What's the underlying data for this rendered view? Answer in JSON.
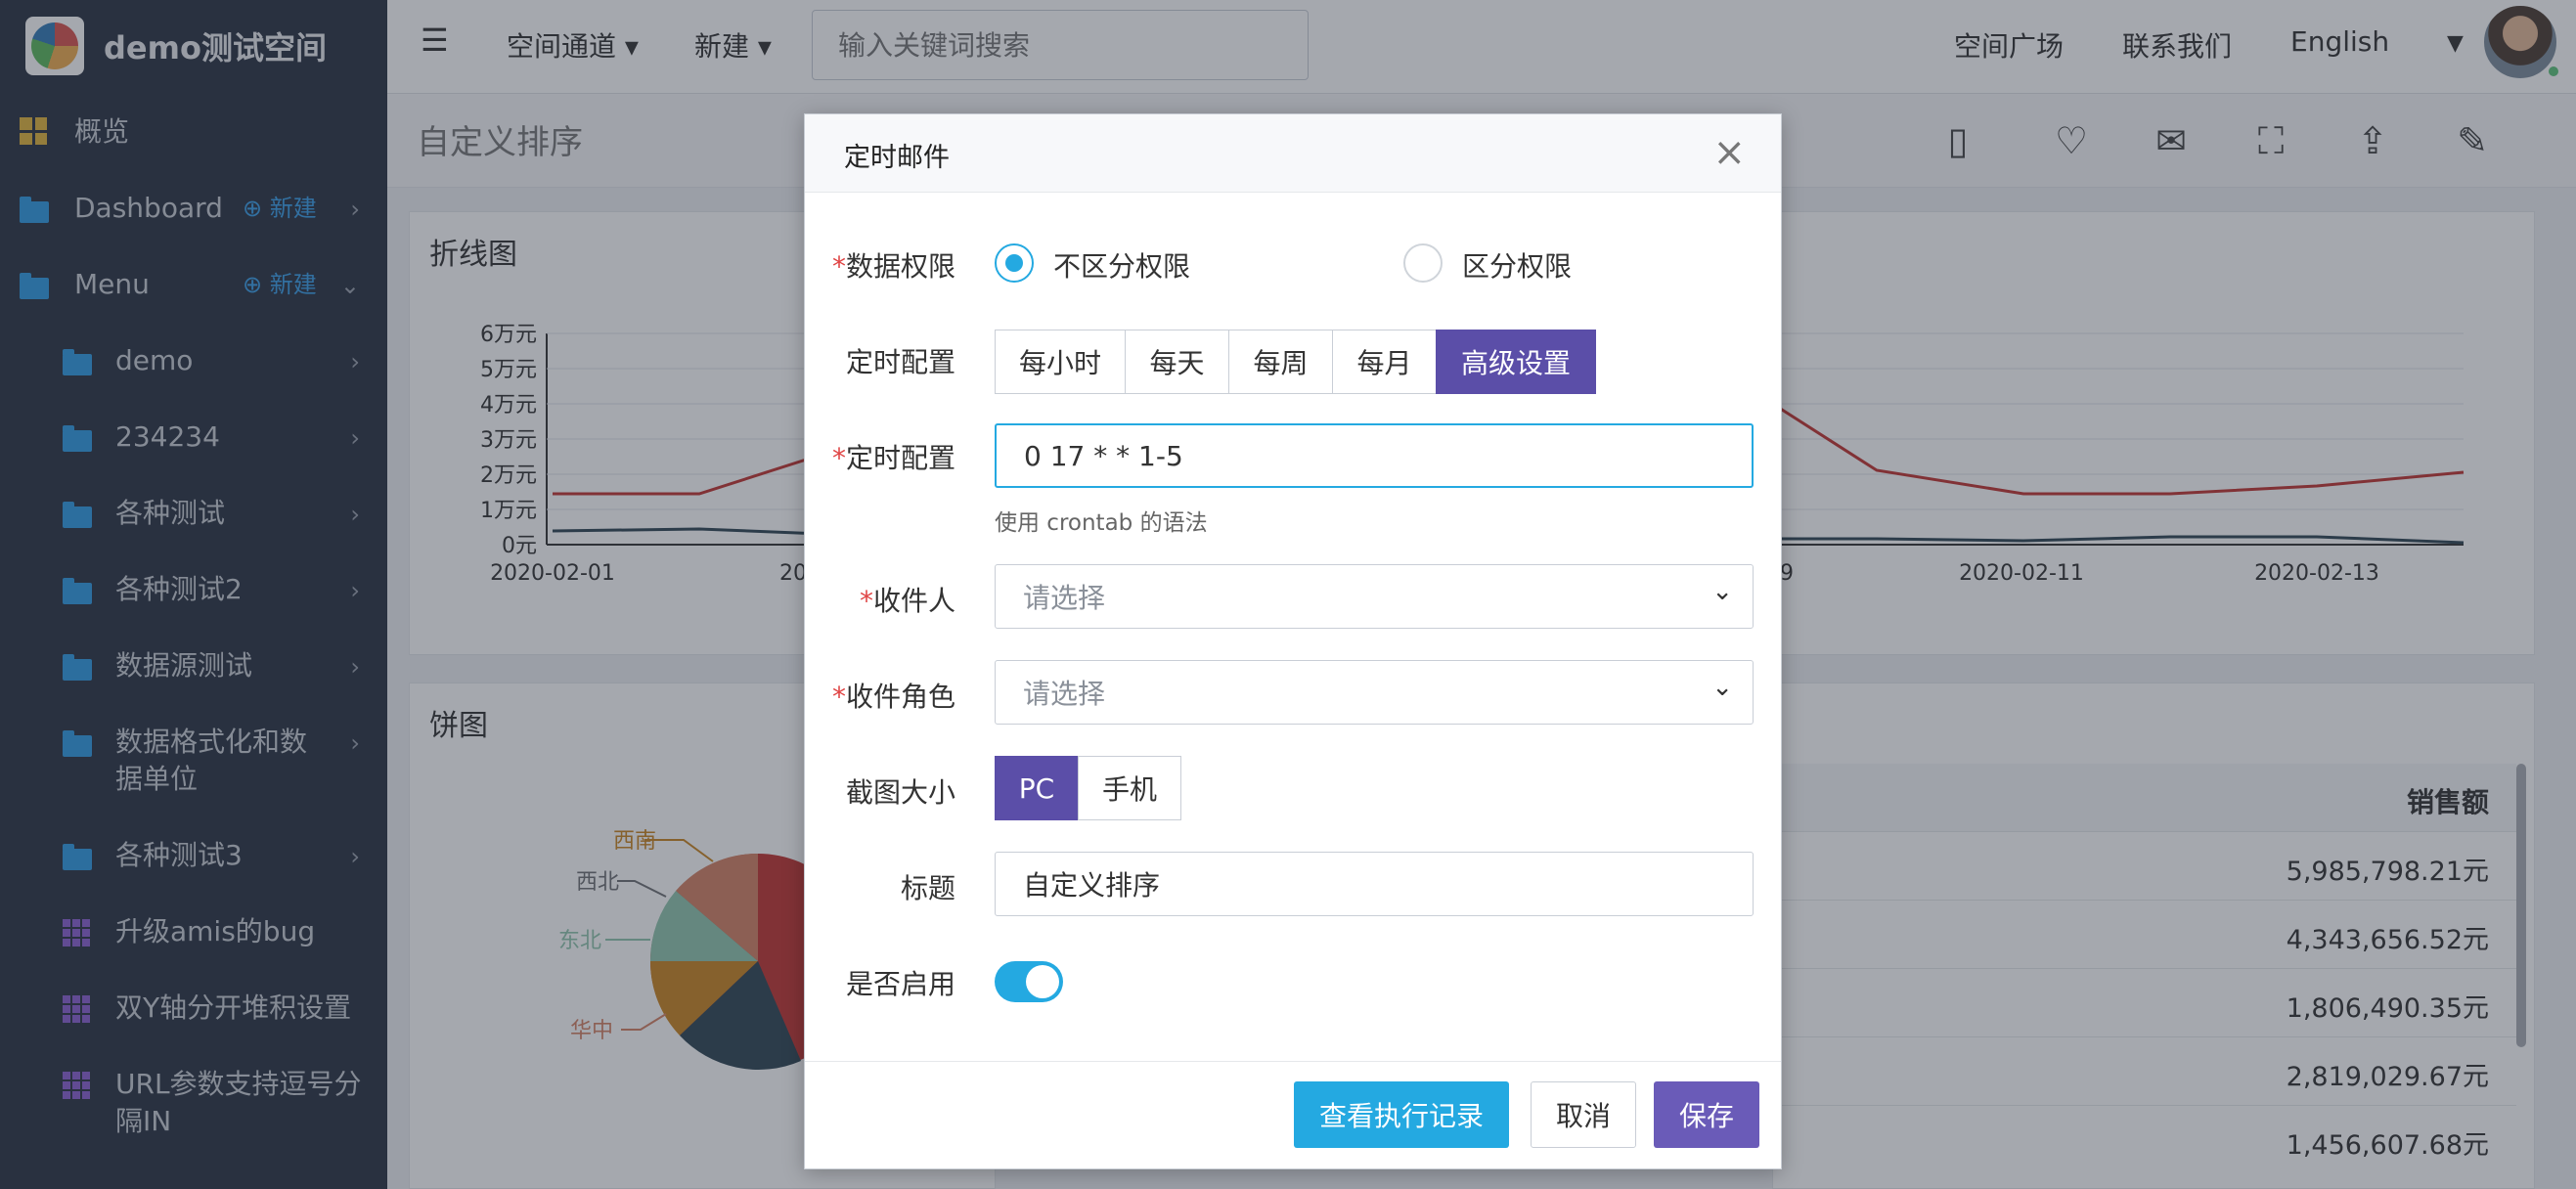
{
  "brand": {
    "name": "demo测试空间"
  },
  "sidebar": {
    "items": [
      {
        "label": "概览",
        "icon": "dashboard-grid-icon"
      },
      {
        "label": "Dashboard",
        "new": "新建",
        "icon": "folder-icon"
      },
      {
        "label": "Menu",
        "new": "新建",
        "icon": "folder-icon"
      },
      {
        "label": "demo",
        "icon": "folder-icon"
      },
      {
        "label": "234234",
        "icon": "folder-icon"
      },
      {
        "label": "各种测试",
        "icon": "folder-icon"
      },
      {
        "label": "各种测试2",
        "icon": "folder-icon"
      },
      {
        "label": "数据源测试",
        "icon": "folder-icon"
      },
      {
        "label": "数据格式化和数据单位",
        "icon": "folder-icon"
      },
      {
        "label": "各种测试3",
        "icon": "folder-icon"
      },
      {
        "label": "升级amis的bug",
        "icon": "grid-icon"
      },
      {
        "label": "双Y轴分开堆积设置",
        "icon": "grid-icon"
      },
      {
        "label": "URL参数支持逗号分隔IN",
        "icon": "grid-icon"
      }
    ]
  },
  "topbar": {
    "space_channel": "空间通道",
    "create": "新建",
    "search_placeholder": "输入关键词搜索",
    "space_square": "空间广场",
    "contact": "联系我们",
    "language": "English"
  },
  "page": {
    "title": "自定义排序"
  },
  "line_panel": {
    "title": "折线图",
    "y_ticks": [
      "6万元",
      "5万元",
      "4万元",
      "3万元",
      "2万元",
      "1万元",
      "0元"
    ],
    "x_ticks_left": [
      "2020-02-01",
      "20"
    ],
    "x_ticks_right": [
      "9",
      "2020-02-11",
      "2020-02-13"
    ]
  },
  "pie_panel": {
    "title": "饼图",
    "labels": [
      "西南",
      "西北",
      "东北",
      "华中"
    ]
  },
  "table_panel": {
    "header": "销售额",
    "values": [
      "5,985,798.21元",
      "4,343,656.52元",
      "1,806,490.35元",
      "2,819,029.67元",
      "1,456,607.68元"
    ]
  },
  "modal": {
    "title": "定时邮件",
    "data_permission": {
      "label": "数据权限",
      "options": [
        "不区分权限",
        "区分权限"
      ],
      "selected": "不区分权限"
    },
    "schedule": {
      "label": "定时配置",
      "options": [
        "每小时",
        "每天",
        "每周",
        "每月",
        "高级设置"
      ],
      "selected": "高级设置"
    },
    "cron": {
      "label": "定时配置",
      "value": "0 17 * * 1-5",
      "hint": "使用 crontab 的语法"
    },
    "recipients": {
      "label": "收件人",
      "placeholder": "请选择"
    },
    "recipient_roles": {
      "label": "收件角色",
      "placeholder": "请选择"
    },
    "screenshot_size": {
      "label": "截图大小",
      "options": [
        "PC",
        "手机"
      ],
      "selected": "PC"
    },
    "subject": {
      "label": "标题",
      "value": "自定义排序"
    },
    "enabled": {
      "label": "是否启用",
      "value": true
    },
    "buttons": {
      "history": "查看执行记录",
      "cancel": "取消",
      "save": "保存"
    }
  },
  "colors": {
    "accent_blue": "#24a9e1",
    "accent_purple": "#5b4ea8",
    "sidebar_bg": "#2a3343",
    "required_red": "#e04545"
  }
}
